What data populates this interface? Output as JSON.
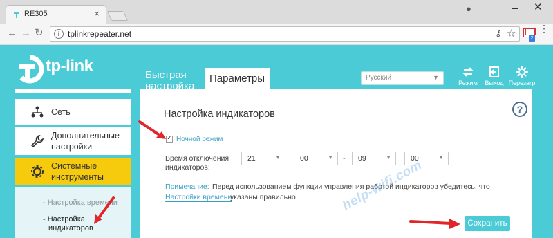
{
  "browser": {
    "tab_title": "RE305",
    "url": "tplinkrepeater.net"
  },
  "header": {
    "logo_text": "tp-link",
    "tabs": [
      {
        "label_line1": "Быстрая",
        "label_line2": "настройка"
      },
      {
        "label": "Параметры"
      }
    ],
    "language": "Русский",
    "buttons": [
      {
        "label": "Режим",
        "icon": "mode-icon"
      },
      {
        "label": "Выход",
        "icon": "logout-icon"
      },
      {
        "label": "Перезагр",
        "icon": "reboot-icon"
      }
    ]
  },
  "sidebar": {
    "items": [
      {
        "label": "Сеть",
        "icon": "network-icon"
      },
      {
        "label_line1": "Дополнительные",
        "label_line2": "настройки",
        "icon": "wrench-icon"
      },
      {
        "label_line1": "Системные",
        "label_line2": "инструменты",
        "icon": "gear-icon"
      }
    ],
    "sub_items": [
      {
        "label": "- Настройка времени"
      },
      {
        "label_line1": "- Настройка",
        "label_line2": "индикаторов"
      }
    ]
  },
  "main": {
    "section_title": "Настройка индикаторов",
    "night_mode_label": "Ночной режим",
    "off_time_label_line1": "Время отключения",
    "off_time_label_line2": "индикаторов:",
    "start_hour": "21",
    "start_minute": "00",
    "separator": "-",
    "end_hour": "09",
    "end_minute": "00",
    "note_label": "Примечание:",
    "note_text": "Перед использованием функции управления работой индикаторов убедитесь, что",
    "note_link": "Настройки времени",
    "note_text2": "указаны правильно.",
    "save_label": "Сохранить"
  },
  "watermark": "help-wifi.com",
  "colors": {
    "accent": "#4acbd6",
    "active_item": "#f7cb0d",
    "link": "#3a9ec4",
    "arrow": "#e0262b"
  }
}
